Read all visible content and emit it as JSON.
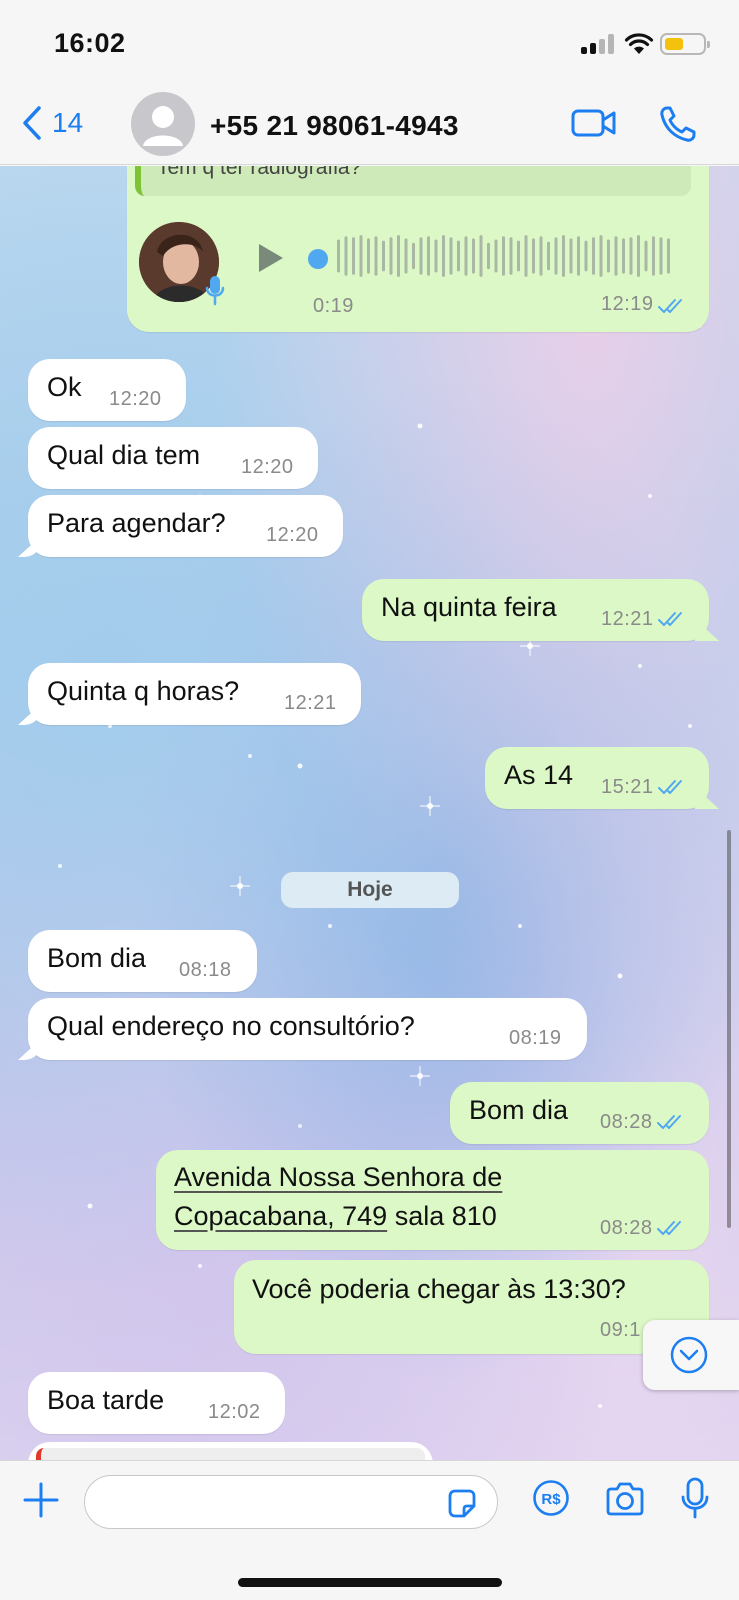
{
  "status_bar": {
    "time": "16:02"
  },
  "header": {
    "back_count": "14",
    "contact": "+55 21 98061-4943"
  },
  "messages": {
    "quoted_text": "Tem q ter radiografia?",
    "voice": {
      "duration": "0:19",
      "time": "12:19"
    },
    "m1": {
      "text": "Ok",
      "time": "12:20"
    },
    "m2": {
      "text": "Qual dia tem",
      "time": "12:20"
    },
    "m3": {
      "text": "Para agendar?",
      "time": "12:20"
    },
    "m4": {
      "text": "Na quinta feira",
      "time": "12:21"
    },
    "m5": {
      "text": "Quinta q horas?",
      "time": "12:21"
    },
    "m6": {
      "text": "As 14",
      "time": "15:21"
    },
    "day_divider": "Hoje",
    "m7": {
      "text": "Bom dia",
      "time": "08:18"
    },
    "m8": {
      "text": "Qual endereço no consultório?",
      "time": "08:19"
    },
    "m9": {
      "text": "Bom dia",
      "time": "08:28"
    },
    "m10": {
      "line1": "Avenida Nossa Senhora de",
      "line2_link": "Copacabana, 749",
      "line2_rest": " sala 810",
      "time": "08:28"
    },
    "m11": {
      "text": "Você poderia chegar às 13:30?",
      "time": "09:1"
    },
    "m12": {
      "text": "Boa  tarde",
      "time": "12:02"
    }
  },
  "footer": {
    "input_placeholder": ""
  },
  "colors": {
    "accent": "#1c7ef0",
    "outgoing_bubble": "#dcf8c6",
    "incoming_bubble": "#ffffff",
    "read_ticks": "#4fa8f0"
  }
}
